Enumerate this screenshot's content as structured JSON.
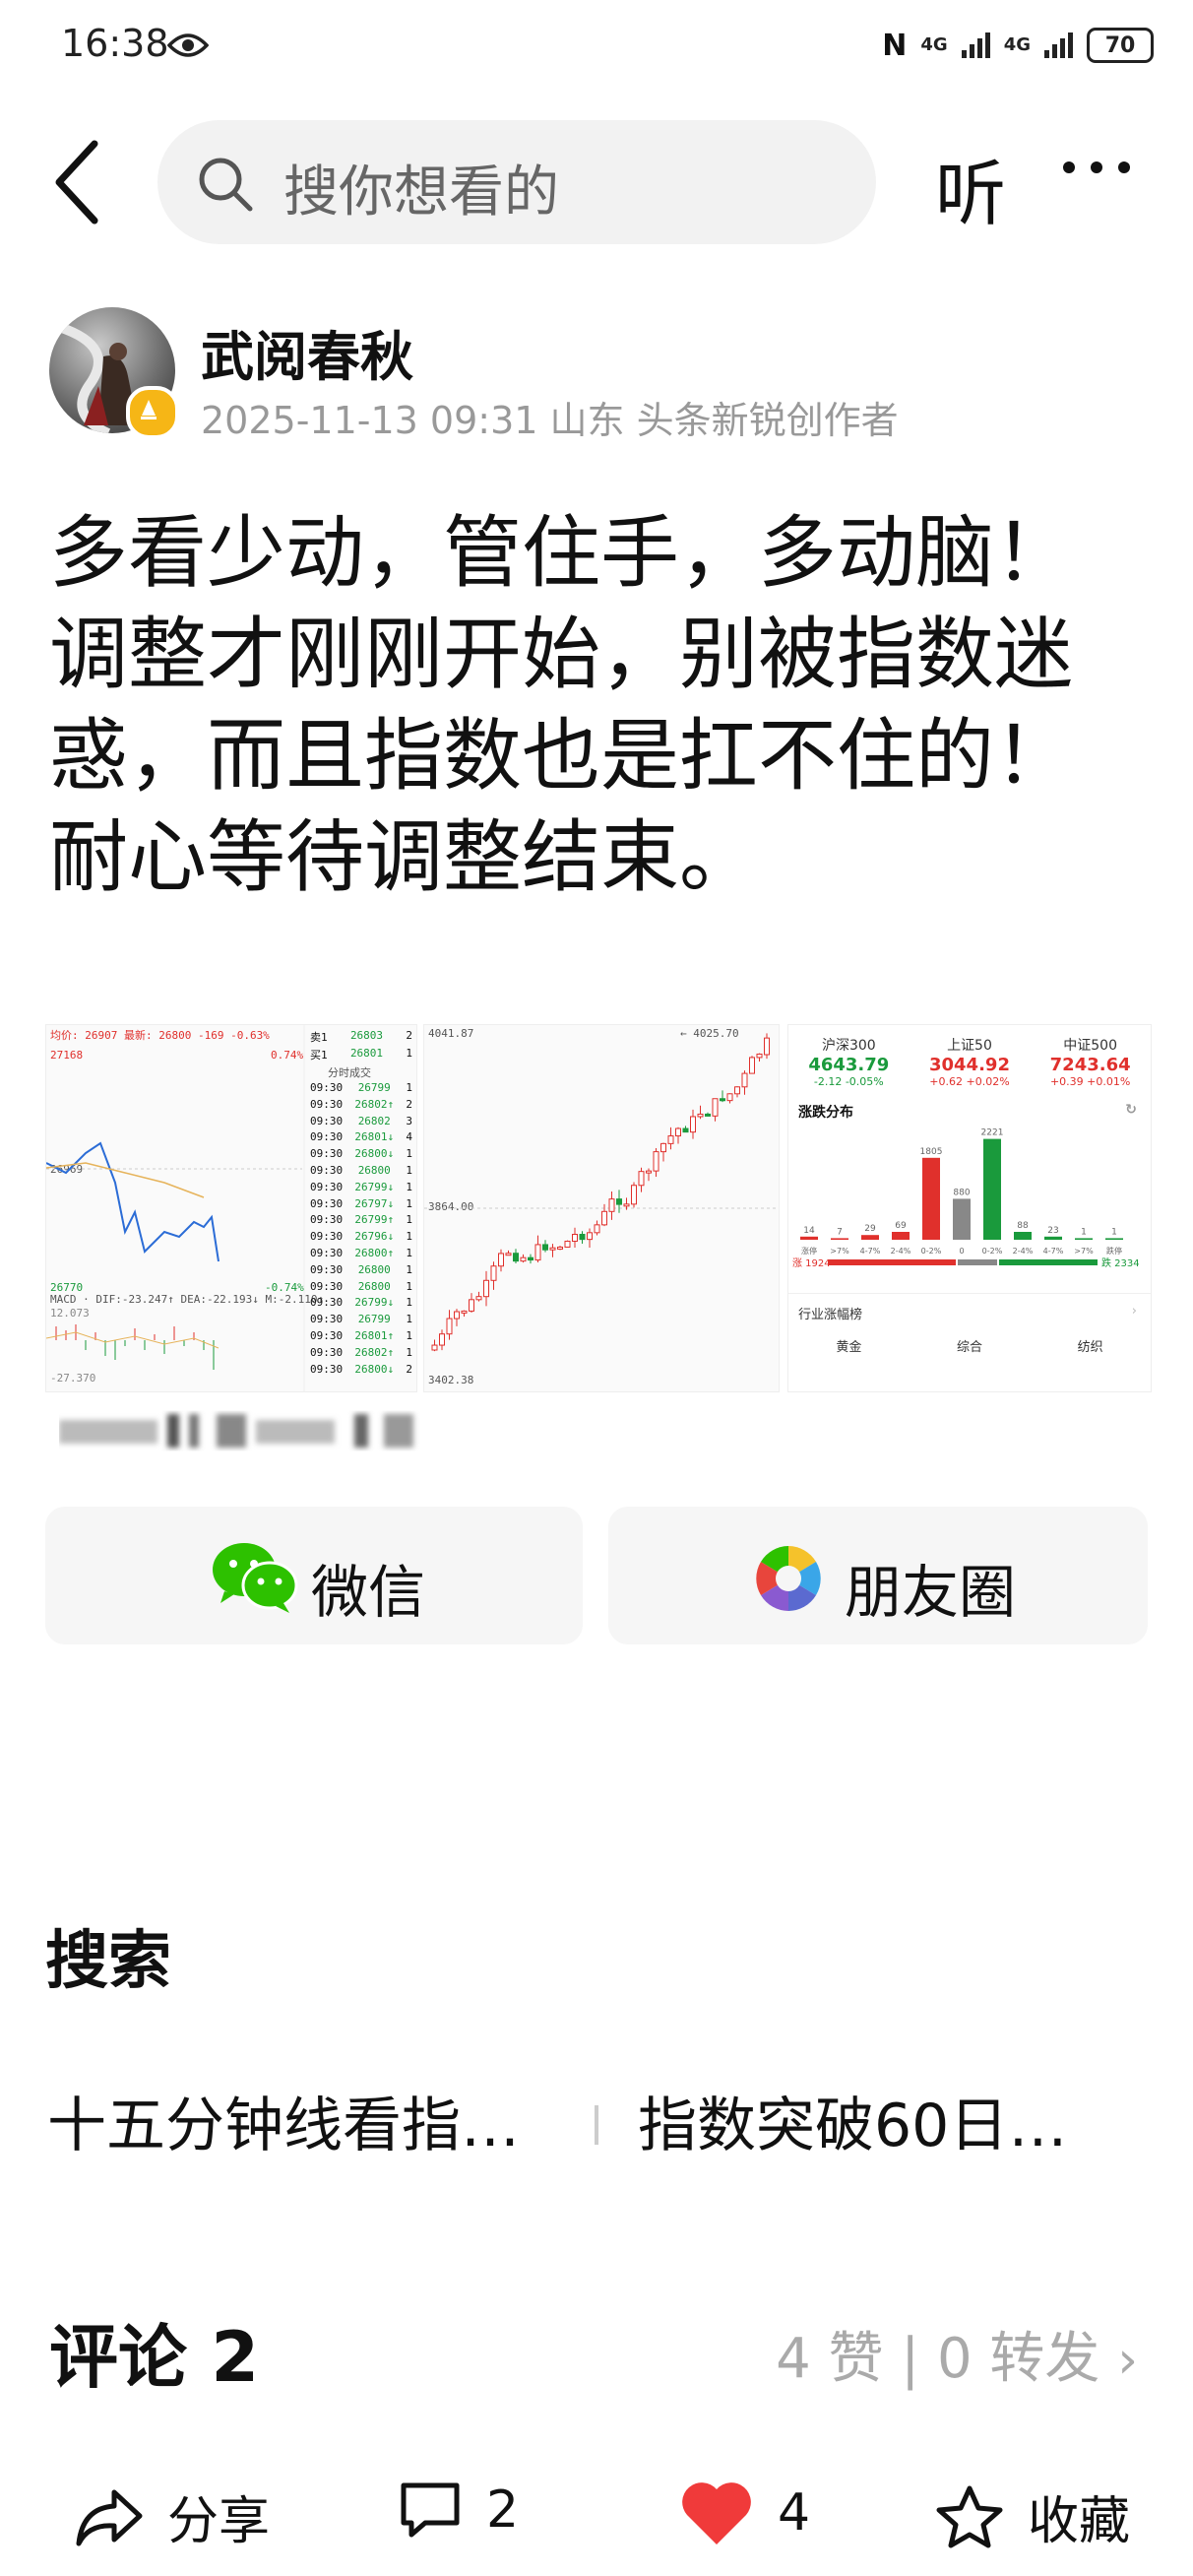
{
  "status_bar": {
    "time": "16:38",
    "battery": "70",
    "network1": "4G",
    "network2": "4G"
  },
  "nav": {
    "search_placeholder": "搜你想看的",
    "listen_label": "听"
  },
  "author": {
    "name": "武阅春秋",
    "meta": "2025-11-13 09:31 山东 头条新锐创作者"
  },
  "post": {
    "lines": [
      "多看少动，管住手，多动脑！",
      "调整才刚刚开始，别被指数迷",
      "惑，而且指数也是扛不住的！",
      "耐心等待调整结束。"
    ]
  },
  "images": {
    "img1": {
      "header": "均价: 26907 最新: 26800 -169 -0.63%",
      "high": "27168",
      "high_pct": "0.74%",
      "mid": "26969",
      "low": "26770",
      "low_pct": "-0.74%",
      "macd": "MACD · DIF:-23.247↑ DEA:-22.193↓ M:-2.110↑",
      "macd_top": "12.073",
      "macd_bottom": "-27.370",
      "sell_label": "卖1",
      "sell_price": "26803",
      "sell_vol": "2",
      "buy_label": "买1",
      "buy_price": "26801",
      "buy_vol": "1",
      "ticks_title": "分时成交",
      "ticks": [
        [
          "09:30",
          "26799",
          "1"
        ],
        [
          "09:30",
          "26802↑",
          "2"
        ],
        [
          "09:30",
          "26802",
          "3"
        ],
        [
          "09:30",
          "26801↓",
          "4"
        ],
        [
          "09:30",
          "26800↓",
          "1"
        ],
        [
          "09:30",
          "26800",
          "1"
        ],
        [
          "09:30",
          "26799↓",
          "1"
        ],
        [
          "09:30",
          "26797↓",
          "1"
        ],
        [
          "09:30",
          "26799↑",
          "1"
        ],
        [
          "09:30",
          "26796↓",
          "1"
        ],
        [
          "09:30",
          "26800↑",
          "1"
        ],
        [
          "09:30",
          "26800",
          "1"
        ],
        [
          "09:30",
          "26800",
          "1"
        ],
        [
          "09:30",
          "26799↓",
          "1"
        ],
        [
          "09:30",
          "26799",
          "1"
        ],
        [
          "09:30",
          "26801↑",
          "1"
        ],
        [
          "09:30",
          "26802↑",
          "1"
        ],
        [
          "09:30",
          "26800↓",
          "2"
        ]
      ]
    },
    "img2": {
      "top_left": "4041.87",
      "top_right": "← 4025.70",
      "mid_left": "3864.00",
      "bottom_left": "3402.38"
    },
    "img3": {
      "indices": [
        {
          "name": "沪深300",
          "value": "4643.79",
          "change": "-2.12 -0.05%",
          "color": "#1a9a3c"
        },
        {
          "name": "上证50",
          "value": "3044.92",
          "change": "+0.62 +0.02%",
          "color": "#e0302c"
        },
        {
          "name": "中证500",
          "value": "7243.64",
          "change": "+0.39 +0.01%",
          "color": "#e0302c"
        }
      ],
      "dist_title": "涨跌分布",
      "bars": [
        {
          "count": "14",
          "label": "涨停",
          "color": "#e0302c",
          "h": 2
        },
        {
          "count": "7",
          "label": ">7%",
          "color": "#e0302c",
          "h": 1
        },
        {
          "count": "29",
          "label": "4-7%",
          "color": "#e0302c",
          "h": 3
        },
        {
          "count": "69",
          "label": "2-4%",
          "color": "#e0302c",
          "h": 5
        },
        {
          "count": "1805",
          "label": "0-2%",
          "color": "#e0302c",
          "h": 52
        },
        {
          "count": "880",
          "label": "0",
          "color": "#888888",
          "h": 26
        },
        {
          "count": "2221",
          "label": "0-2%",
          "color": "#1a9a3c",
          "h": 64
        },
        {
          "count": "88",
          "label": "2-4%",
          "color": "#1a9a3c",
          "h": 5
        },
        {
          "count": "23",
          "label": "4-7%",
          "color": "#1a9a3c",
          "h": 2
        },
        {
          "count": "1",
          "label": ">7%",
          "color": "#1a9a3c",
          "h": 1
        },
        {
          "count": "1",
          "label": "跌停",
          "color": "#1a9a3c",
          "h": 1
        }
      ],
      "up_count": "涨 1924",
      "down_count": "跌 2334",
      "industry_title": "行业涨幅榜",
      "industries": [
        "黄金",
        "综合",
        "纺织"
      ]
    }
  },
  "share": {
    "wechat": "微信",
    "moments": "朋友圈"
  },
  "search_section": {
    "title": "搜索",
    "suggestions": [
      "十五分钟线看指…",
      "指数突破60日…"
    ]
  },
  "comments": {
    "title": "评论 2",
    "stats": "4 赞 | 0 转发"
  },
  "bottom_bar": {
    "share": "分享",
    "comments": "2",
    "likes": "4",
    "favorite": "收藏"
  },
  "colors": {
    "red": "#e0302c",
    "green": "#1a9a3c",
    "wechat_green": "#2dc100"
  }
}
